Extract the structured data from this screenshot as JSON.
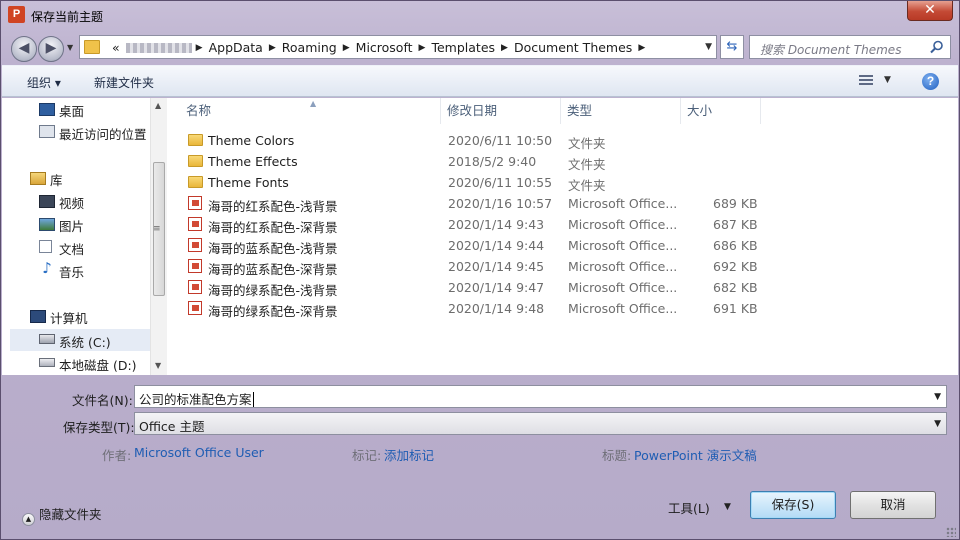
{
  "app_icon_label": "P",
  "window": {
    "title": "保存当前主题",
    "close_glyph": "✕"
  },
  "address": {
    "crumbs": [
      "«",
      "AppData",
      "Roaming",
      "Microsoft",
      "Templates",
      "Document Themes"
    ],
    "search_placeholder": "搜索 Document Themes"
  },
  "toolbar": {
    "organize": "组织 ▾",
    "new_folder": "新建文件夹",
    "help": "?"
  },
  "nav": {
    "items": [
      {
        "label": "桌面",
        "icon": "desktop-icon"
      },
      {
        "label": "最近访问的位置",
        "icon": "recent-places-icon"
      },
      {
        "label": "库",
        "icon": "libraries-icon"
      },
      {
        "label": "视频",
        "icon": "video-icon"
      },
      {
        "label": "图片",
        "icon": "pictures-icon"
      },
      {
        "label": "文档",
        "icon": "documents-icon"
      },
      {
        "label": "音乐",
        "icon": "music-icon"
      },
      {
        "label": "计算机",
        "icon": "computer-icon"
      },
      {
        "label": "系统 (C:)",
        "icon": "drive-c-icon"
      },
      {
        "label": "本地磁盘 (D:)",
        "icon": "drive-d-icon"
      }
    ]
  },
  "columns": {
    "name": "名称",
    "date": "修改日期",
    "type": "类型",
    "size": "大小"
  },
  "files": [
    {
      "name": "Theme Colors",
      "date": "2020/6/11 10:50",
      "type": "文件夹",
      "size": "",
      "kind": "folder"
    },
    {
      "name": "Theme Effects",
      "date": "2018/5/2 9:40",
      "type": "文件夹",
      "size": "",
      "kind": "folder"
    },
    {
      "name": "Theme Fonts",
      "date": "2020/6/11 10:55",
      "type": "文件夹",
      "size": "",
      "kind": "folder"
    },
    {
      "name": "海哥的红系配色-浅背景",
      "date": "2020/1/16 10:57",
      "type": "Microsoft Office...",
      "size": "689 KB",
      "kind": "thmx"
    },
    {
      "name": "海哥的红系配色-深背景",
      "date": "2020/1/14 9:43",
      "type": "Microsoft Office...",
      "size": "687 KB",
      "kind": "thmx"
    },
    {
      "name": "海哥的蓝系配色-浅背景",
      "date": "2020/1/14 9:44",
      "type": "Microsoft Office...",
      "size": "686 KB",
      "kind": "thmx"
    },
    {
      "name": "海哥的蓝系配色-深背景",
      "date": "2020/1/14 9:45",
      "type": "Microsoft Office...",
      "size": "692 KB",
      "kind": "thmx"
    },
    {
      "name": "海哥的绿系配色-浅背景",
      "date": "2020/1/14 9:47",
      "type": "Microsoft Office...",
      "size": "682 KB",
      "kind": "thmx"
    },
    {
      "name": "海哥的绿系配色-深背景",
      "date": "2020/1/14 9:48",
      "type": "Microsoft Office...",
      "size": "691 KB",
      "kind": "thmx"
    }
  ],
  "form": {
    "filename_label": "文件名(N):",
    "filename_value": "公司的标准配色方案",
    "savetype_label": "保存类型(T):",
    "savetype_value": "Office 主题",
    "author_label": "作者:",
    "author_value": "Microsoft Office User",
    "tags_label": "标记:",
    "tags_value": "添加标记",
    "title_label": "标题:",
    "title_value": "PowerPoint 演示文稿"
  },
  "footer": {
    "hide_folders": "隐藏文件夹",
    "tools": "工具(L)",
    "save": "保存(S)",
    "cancel": "取消"
  }
}
